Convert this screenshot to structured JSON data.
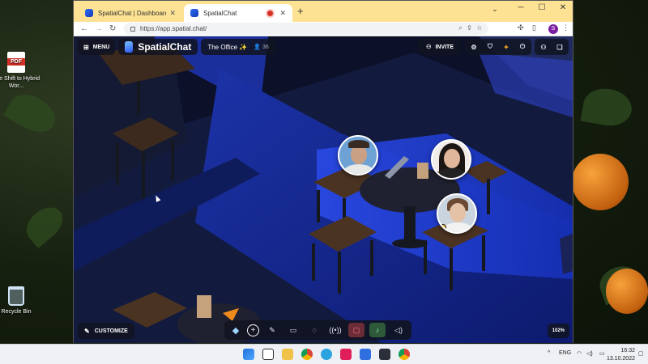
{
  "desktop": {
    "icons": [
      {
        "label": "The Shift to Hybrid Wor...",
        "icon": "pdf-icon"
      },
      {
        "label": "Recycle Bin",
        "icon": "recycle-bin-icon"
      }
    ]
  },
  "browser": {
    "tabs": [
      {
        "title": "SpatialChat | Dashboard",
        "active": false
      },
      {
        "title": "SpatialChat",
        "active": true,
        "recording": true
      }
    ],
    "url": "https://app.spatial.chat/",
    "profile_initial": "S"
  },
  "app": {
    "menu_label": "MENU",
    "brand": "SpatialChat",
    "room_name": "The Office ✨",
    "user_count": "36",
    "invite_label": "INVITE",
    "customize_label": "CUSTOMIZE",
    "zoom_level": "102%"
  },
  "taskbar": {
    "language": "ENG",
    "time": "16:32",
    "date": "13.10.2022"
  }
}
